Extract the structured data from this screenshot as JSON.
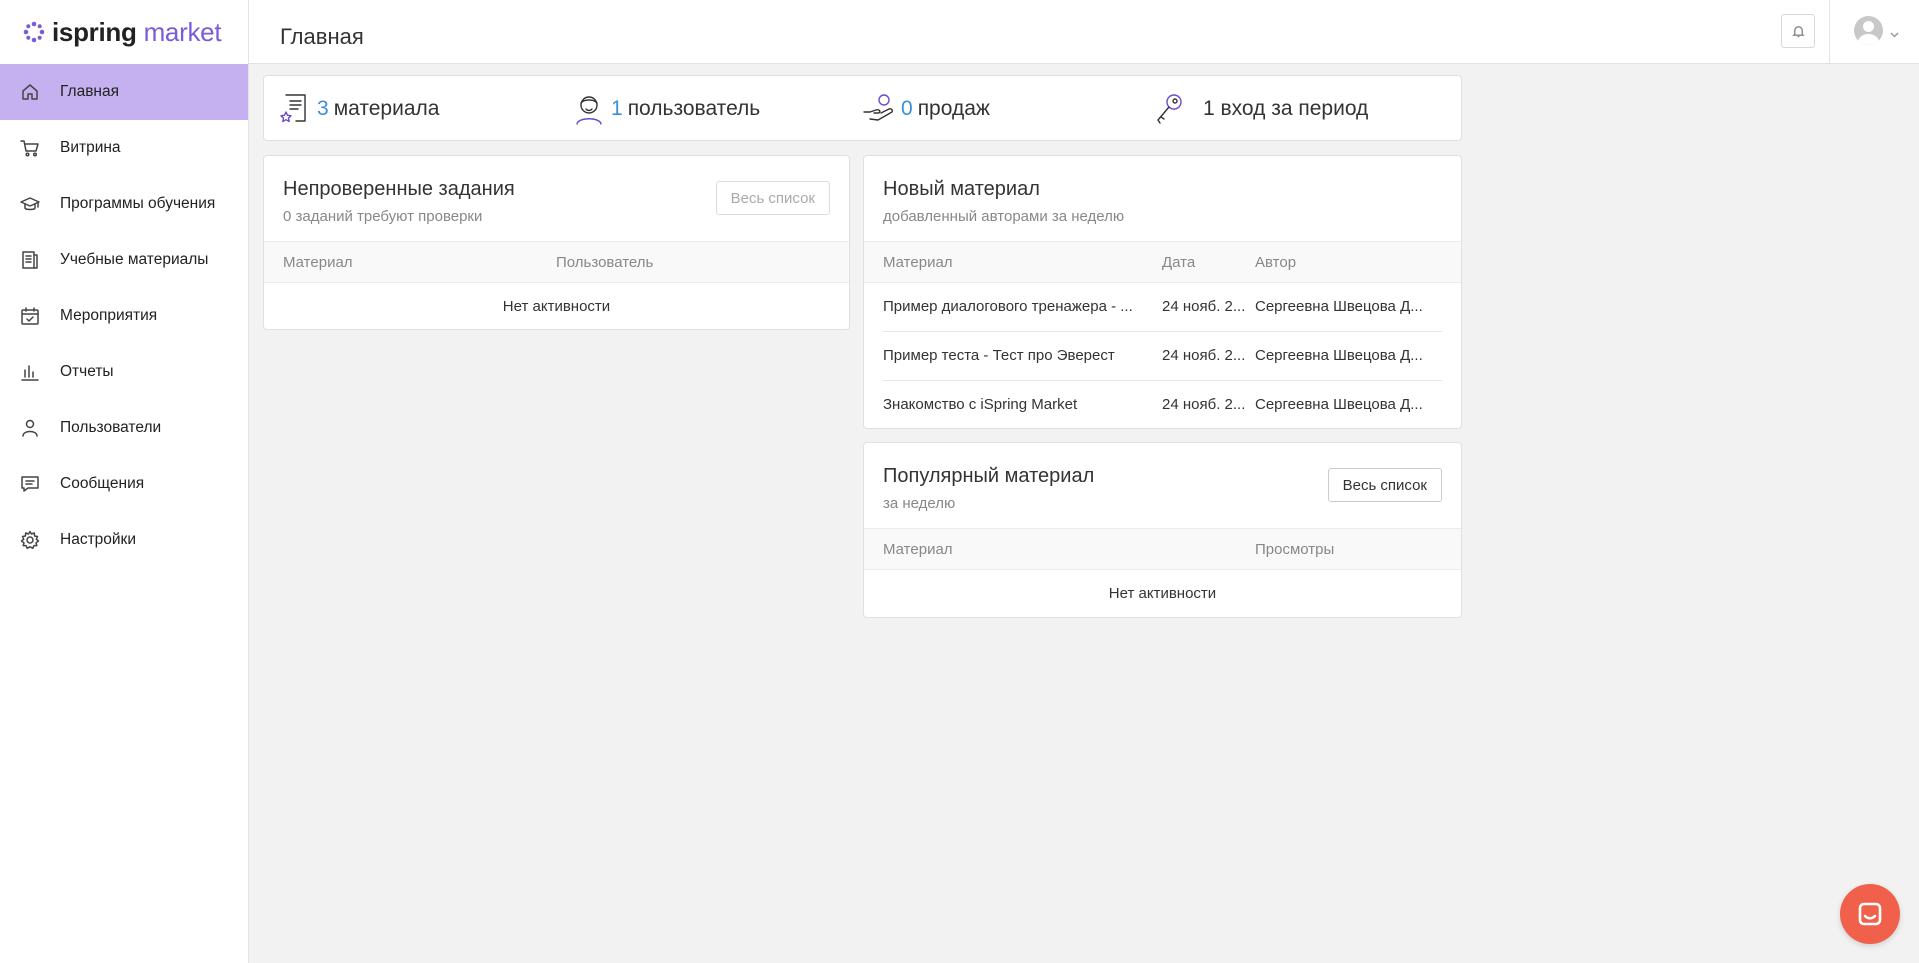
{
  "logo": {
    "brand": "ispring",
    "market": "market",
    "accent": "#7a5cd6"
  },
  "sidebar": {
    "items": [
      {
        "label": "Главная",
        "icon": "home-icon",
        "active": true
      },
      {
        "label": "Витрина",
        "icon": "cart-icon"
      },
      {
        "label": "Программы обучения",
        "icon": "graduation-cap-icon"
      },
      {
        "label": "Учебные материалы",
        "icon": "document-list-icon"
      },
      {
        "label": "Мероприятия",
        "icon": "calendar-check-icon"
      },
      {
        "label": "Отчеты",
        "icon": "bar-chart-icon"
      },
      {
        "label": "Пользователи",
        "icon": "user-icon"
      },
      {
        "label": "Сообщения",
        "icon": "message-icon"
      },
      {
        "label": "Настройки",
        "icon": "gear-icon"
      }
    ],
    "active_color": "#c5b1f0"
  },
  "header": {
    "title": "Главная",
    "bell_icon": "bell-icon",
    "avatar_icon": "user-avatar-icon"
  },
  "stats": {
    "materials": {
      "num": "3",
      "label": "материала",
      "icon": "certificate-doc-icon"
    },
    "users": {
      "num": "1",
      "label": "пользователь",
      "icon": "person-icon"
    },
    "sales": {
      "num": "0",
      "label": "продаж",
      "icon": "hand-coin-icon"
    },
    "logins": {
      "text": "1 вход за период",
      "icon": "key-icon"
    },
    "num_color": "#3d8fd6"
  },
  "unchecked": {
    "title": "Непроверенные задания",
    "subtitle": "0 заданий требуют проверки",
    "button": "Весь список",
    "columns": [
      "Материал",
      "Пользователь"
    ],
    "empty": "Нет активности"
  },
  "new_material": {
    "title": "Новый материал",
    "subtitle": "добавленный авторами за неделю",
    "columns": [
      "Материал",
      "Дата",
      "Автор"
    ],
    "rows": [
      {
        "material": "Пример диалогового тренажера - ...",
        "date": "24 нояб. 2...",
        "author": "Сергеевна Швецова Д..."
      },
      {
        "material": "Пример теста - Тест про Эверест",
        "date": "24 нояб. 2...",
        "author": "Сергеевна Швецова Д..."
      },
      {
        "material": "Знакомство с iSpring Market",
        "date": "24 нояб. 2...",
        "author": "Сергеевна Швецова Д..."
      }
    ]
  },
  "popular": {
    "title": "Популярный материал",
    "subtitle": "за неделю",
    "button": "Весь список",
    "columns": [
      "Материал",
      "Просмотры"
    ],
    "empty": "Нет активности"
  },
  "chat_widget": {
    "icon": "chat-icon",
    "color": "#f0604a"
  }
}
